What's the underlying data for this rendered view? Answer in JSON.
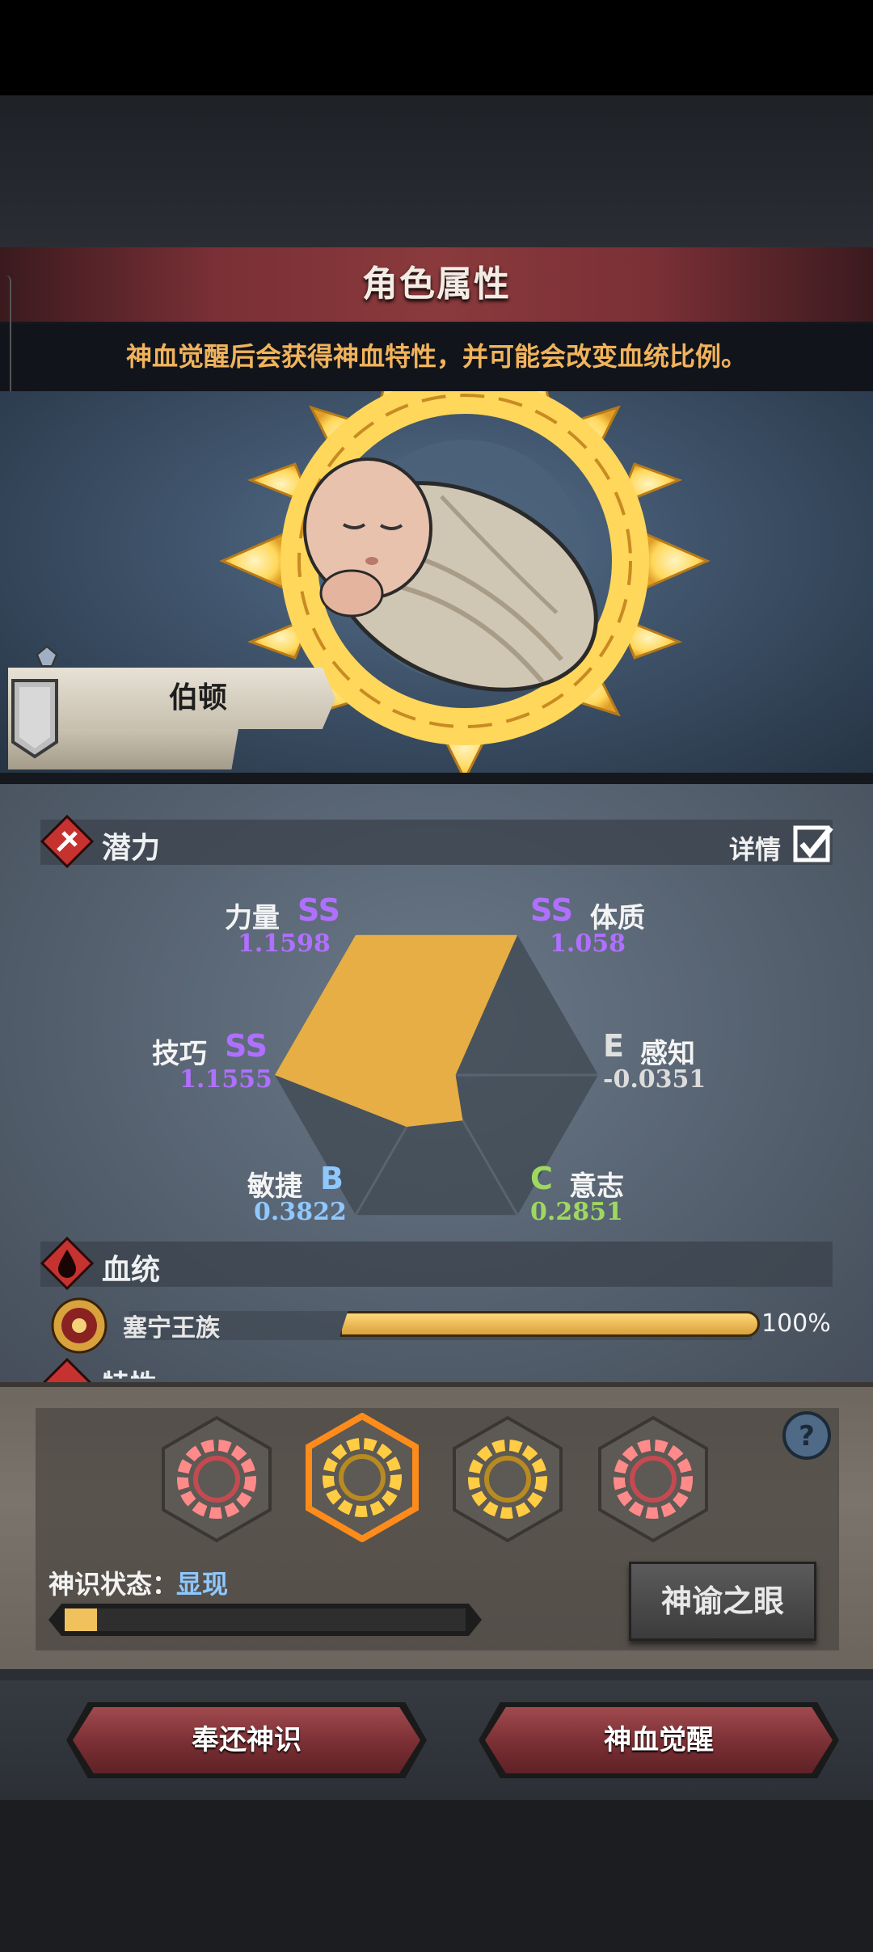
{
  "header": {
    "title": "角色属性",
    "hint": "神血觉醒后会获得神血特性，并可能会改变血统比例。"
  },
  "character": {
    "name": "伯顿"
  },
  "potential": {
    "section_title": "潜力",
    "detail_label": "详情",
    "detail_checked": true,
    "stats": [
      {
        "name": "力量",
        "grade": "SS",
        "value": "1.1598",
        "grade_color": "#b070ff"
      },
      {
        "name": "体质",
        "grade": "SS",
        "value": "1.058",
        "grade_color": "#b070ff"
      },
      {
        "name": "感知",
        "grade": "E",
        "value": "-0.0351",
        "grade_color": "#e0e0e0"
      },
      {
        "name": "意志",
        "grade": "C",
        "value": "0.2851",
        "grade_color": "#9ed860"
      },
      {
        "name": "敏捷",
        "grade": "B",
        "value": "0.3822",
        "grade_color": "#8ec8ff"
      },
      {
        "name": "技巧",
        "grade": "SS",
        "value": "1.1555",
        "grade_color": "#b070ff"
      }
    ],
    "radar_levels": [
      1.0,
      1.0,
      0.02,
      0.25,
      0.3,
      1.0
    ]
  },
  "bloodline": {
    "section_title": "血统",
    "lineages": [
      {
        "name": "塞宁王族",
        "percent_text": "100%",
        "fraction": 1.0
      }
    ]
  },
  "trait_section_title": "特性",
  "divine": {
    "slots": [
      {
        "name": "red-sun-emblem",
        "color": "#ff8a8a",
        "selected": false
      },
      {
        "name": "gold-sun-emblem",
        "color": "#ffcc44",
        "selected": true
      },
      {
        "name": "gold-sun-emblem",
        "color": "#ffcc44",
        "selected": false
      },
      {
        "name": "red-sun-emblem",
        "color": "#ff8a8a",
        "selected": false
      }
    ],
    "status_label": "神识状态：",
    "status_value": "显现",
    "progress_fraction": 0.08,
    "oracle_button": "神谕之眼"
  },
  "actions": {
    "return_button": "奉还神识",
    "awaken_button": "神血觉醒"
  }
}
